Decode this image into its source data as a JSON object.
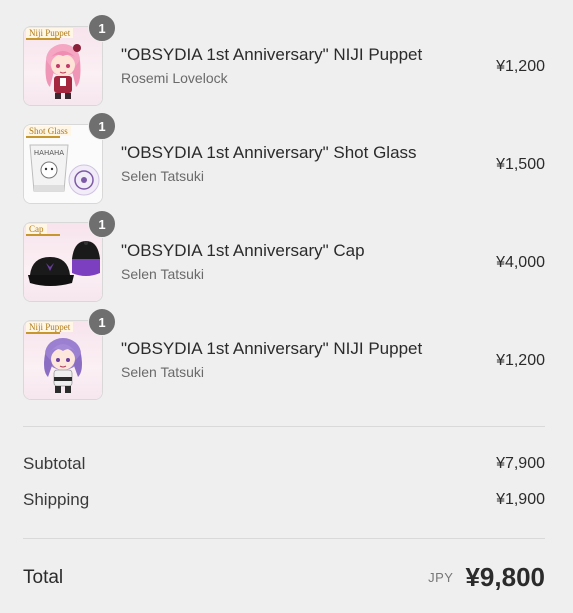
{
  "items": [
    {
      "name": "\"OBSYDIA 1st Anniversary\" NIJI Puppet",
      "variant": "Rosemi Lovelock",
      "price": "¥1,200",
      "qty": "1",
      "tag": "Niji Puppet",
      "icon": "puppet-rosemi-image"
    },
    {
      "name": "\"OBSYDIA 1st Anniversary\" Shot Glass",
      "variant": "Selen Tatsuki",
      "price": "¥1,500",
      "qty": "1",
      "tag": "Shot Glass",
      "icon": "shot-glass-image"
    },
    {
      "name": "\"OBSYDIA 1st Anniversary\" Cap",
      "variant": "Selen Tatsuki",
      "price": "¥4,000",
      "qty": "1",
      "tag": "Cap",
      "icon": "cap-image"
    },
    {
      "name": "\"OBSYDIA 1st Anniversary\" NIJI Puppet",
      "variant": "Selen Tatsuki",
      "price": "¥1,200",
      "qty": "1",
      "tag": "Niji Puppet",
      "icon": "puppet-selen-image"
    }
  ],
  "summary": {
    "subtotal_label": "Subtotal",
    "subtotal_value": "¥7,900",
    "shipping_label": "Shipping",
    "shipping_value": "¥1,900",
    "total_label": "Total",
    "currency": "JPY",
    "total_value": "¥9,800"
  },
  "colors": {
    "background": "#efefef",
    "badge": "#6f6f6f",
    "divider": "#d9d9d9"
  }
}
